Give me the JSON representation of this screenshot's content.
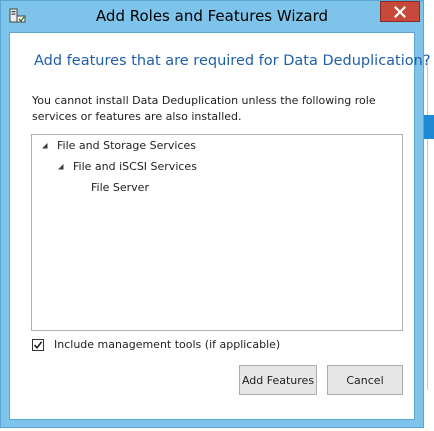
{
  "window": {
    "title": "Add Roles and Features Wizard",
    "close_label": "×",
    "frame_color": "#7EC3EA",
    "close_color": "#C7493B"
  },
  "dialog": {
    "heading": "Add features that are required for Data Deduplication?",
    "heading_color": "#1F5FA8",
    "message": "You cannot install Data Deduplication unless the following role services or features are also installed."
  },
  "tree": {
    "items": [
      {
        "label": "File and Storage Services",
        "expanded": true
      },
      {
        "label": "File and iSCSI Services",
        "expanded": true
      },
      {
        "label": "File Server",
        "expanded": false
      }
    ]
  },
  "options": {
    "include_tools_label": "Include management tools (if applicable)",
    "include_tools_checked": true
  },
  "buttons": {
    "add_label": "Add Features",
    "cancel_label": "Cancel"
  }
}
